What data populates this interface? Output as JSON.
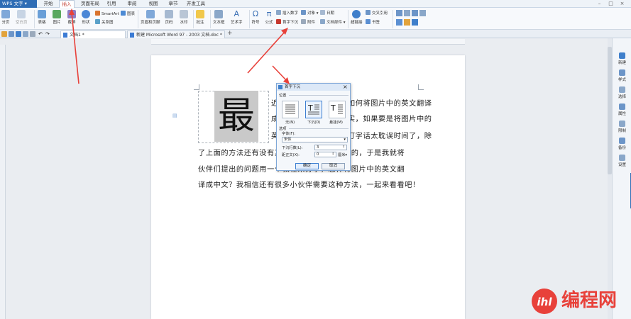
{
  "app": {
    "title": "WPS 文字"
  },
  "menu": [
    "开始",
    "插入",
    "页面布局",
    "引用",
    "审阅",
    "视图",
    "章节",
    "开发工具"
  ],
  "ribbon": {
    "group1": [
      "分页",
      "空白页"
    ],
    "group2": [
      "表格",
      "图片",
      "截屏",
      "形状"
    ],
    "smartart": "SmartArt",
    "chart": "图表",
    "relation": "关系图",
    "header_footer": "页眉和页脚",
    "page_num": "页码",
    "watermark": "水印",
    "comment": "批注",
    "textbox": "文本框",
    "wordart": "艺术字",
    "symbol": "符号",
    "formula": "公式",
    "insert_number": "插入数字",
    "object": "对象",
    "date": "日期",
    "dropcap": "首字下沉",
    "attachment": "附件",
    "doc_parts": "文档部件",
    "hyperlink": "超链接",
    "crossref": "交叉引用",
    "bookmark": "书签"
  },
  "tabs": [
    {
      "label": "文档1 *"
    },
    {
      "label": "新建 Microsoft Word 97 - 2003 文档.doc *"
    }
  ],
  "tab_add": "+",
  "document": {
    "big_char": "最",
    "lines": [
      "近有很多小伙伴问我，如何将图片中的英文翻译",
      "成中文，有方法的！其实，如果要是将图片中的",
      "英文翻译成中文，手动打字话太耽误时间了，除",
      "了上面的方法还有没有其他方法呢？当然是有的，于是我就将",
      "伙伴们提出的问题用一个教程来分享，怎样将图片中的英文翻",
      "译成中文？我相信还有很多小伙伴需要这种方法，一起来看看吧！"
    ]
  },
  "dialog": {
    "title": "首字下沉",
    "position_label": "位置",
    "options": [
      "无(N)",
      "下沉(D)",
      "悬挂(M)"
    ],
    "options_section": "选项",
    "font_label": "字体(F):",
    "font_value": "宋体",
    "lines_label": "下沉行数(L):",
    "lines_value": "3",
    "distance_label": "距正文(X):",
    "distance_value": "0",
    "distance_unit": "厘米",
    "ok": "确定",
    "cancel": "取消",
    "close": "×"
  },
  "right_panel": [
    "新建",
    "样式",
    "选择",
    "属性",
    "限制",
    "备份",
    "设置"
  ],
  "watermark": {
    "text": "编程网"
  },
  "colors": {
    "brand": "#2f6db5",
    "accent": "#e8413a",
    "dialog_border": "#7ea7d8"
  }
}
